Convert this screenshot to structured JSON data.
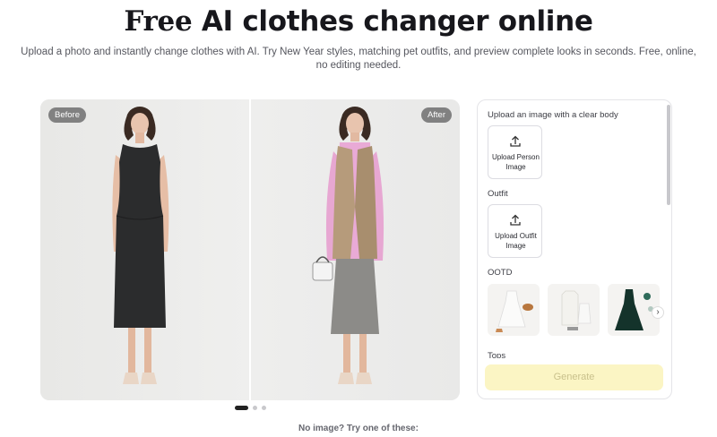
{
  "header": {
    "title_highlight": "Free",
    "title_rest": " AI clothes changer online",
    "subtitle": "Upload a photo and instantly change clothes with AI. Try New Year styles, matching pet outfits, and preview complete looks in seconds. Free, online, no editing needed."
  },
  "compare": {
    "before_label": "Before",
    "after_label": "After",
    "carousel_pages": 3,
    "active_page": 1
  },
  "panel": {
    "person_section_label": "Upload an image with a clear body",
    "person_upload_label": "Upload Person Image",
    "outfit_section_label": "Outfit",
    "outfit_upload_label": "Upload Outfit Image",
    "ootd_section_label": "OOTD",
    "tops_section_label": "Tops",
    "generate_label": "Generate",
    "next_icon": "chevron-right-icon"
  },
  "footer": {
    "hint": "No image? Try one of these:"
  },
  "colors": {
    "highlight": "#f5ef3d",
    "generate_bg": "#fbf5c4",
    "tag_bg": "#6e6e6e"
  }
}
